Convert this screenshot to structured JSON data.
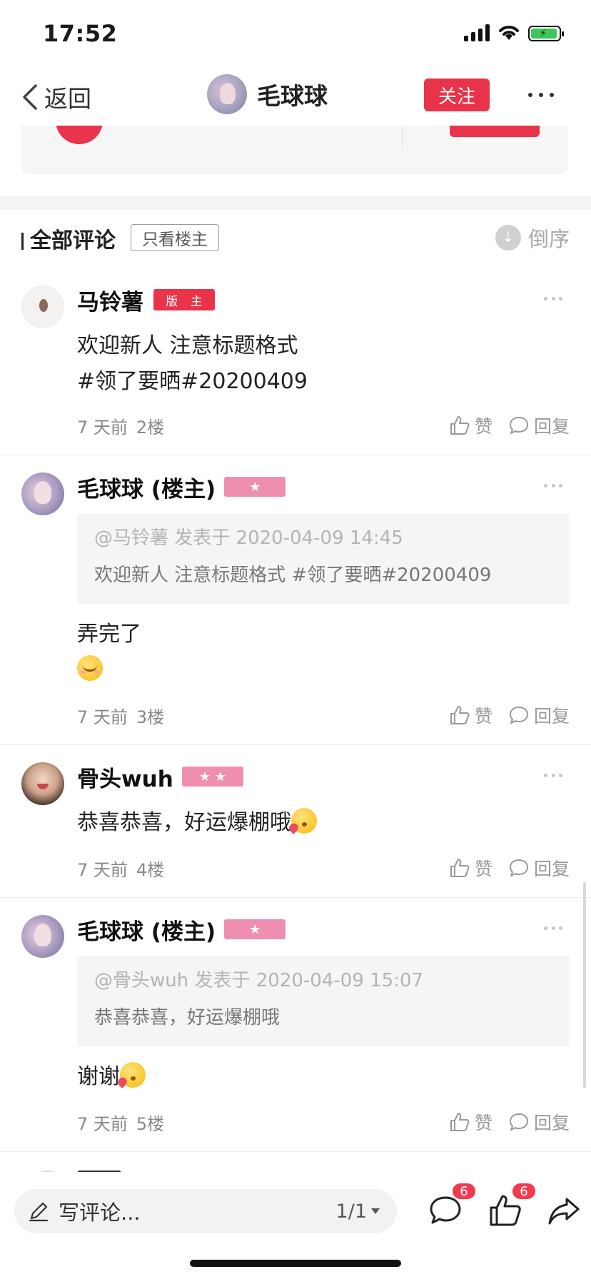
{
  "status_bar": {
    "time": "17:52"
  },
  "nav": {
    "back_label": "返回",
    "title": "毛球球",
    "follow_label": "关注"
  },
  "comments_header": {
    "title": "全部评论",
    "only_host_label": "只看楼主",
    "sort_label": "倒序"
  },
  "comments": [
    {
      "name": "马铃薯",
      "badge": "版 主",
      "body_line1": "欢迎新人 注意标题格式",
      "body_line2": "#领了要晒#20200409",
      "time": "7 天前",
      "floor": "2楼",
      "like_label": "赞",
      "reply_label": "回复"
    },
    {
      "name": "毛球球 (楼主)",
      "badge": "★",
      "quote_meta": "@马铃薯 发表于 2020-04-09 14:45",
      "quote_text": "欢迎新人 注意标题格式 #领了要晒#20200409",
      "body_line1": "弄完了",
      "emoji": "blush-emoji",
      "time": "7 天前",
      "floor": "3楼",
      "like_label": "赞",
      "reply_label": "回复"
    },
    {
      "name": "骨头wuh",
      "badge": "★ ★",
      "body_line1": "恭喜恭喜，好运爆棚哦",
      "emoji": "kiss-heart-emoji",
      "time": "7 天前",
      "floor": "4楼",
      "like_label": "赞",
      "reply_label": "回复"
    },
    {
      "name": "毛球球 (楼主)",
      "badge": "★",
      "quote_meta": "@骨头wuh 发表于 2020-04-09 15:07",
      "quote_text": "恭喜恭喜，好运爆棚哦",
      "body_line1": "谢谢",
      "emoji": "kiss-heart-emoji",
      "time": "7 天前",
      "floor": "5楼",
      "like_label": "赞",
      "reply_label": "回复"
    }
  ],
  "bottom_bar": {
    "input_placeholder": "写评论...",
    "page_indicator": "1/1",
    "comment_count": "6",
    "like_count": "6"
  },
  "colors": {
    "accent_red": "#e8334a",
    "star_badge_pink": "#ee8fb0",
    "notification_red": "#f23a4f"
  }
}
